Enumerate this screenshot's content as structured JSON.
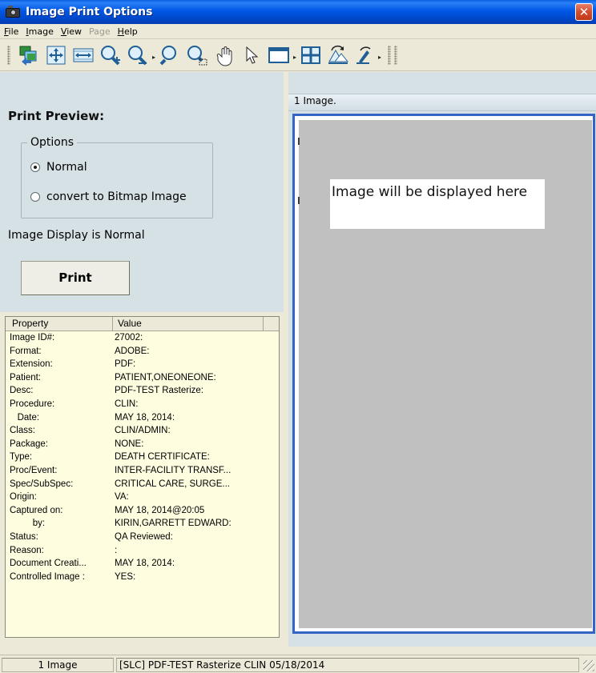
{
  "window": {
    "title": "Image Print Options",
    "close_glyph": "✕"
  },
  "menu": [
    {
      "label": "File",
      "hotkey": "F",
      "rest": "ile",
      "enabled": true
    },
    {
      "label": "Image",
      "hotkey": "I",
      "rest": "mage",
      "enabled": true
    },
    {
      "label": "View",
      "hotkey": "V",
      "rest": "iew",
      "enabled": true
    },
    {
      "label": "Page",
      "hotkey": "P",
      "rest": "age",
      "enabled": false
    },
    {
      "label": "Help",
      "hotkey": "H",
      "rest": "elp",
      "enabled": true
    }
  ],
  "toolbar": {
    "icons": [
      "copy-images-icon",
      "fit-to-window-icon",
      "fit-to-width-icon",
      "zoom-in-icon",
      "zoom-out-icon",
      "zoom-actual-icon",
      "zoom-rectangle-icon",
      "pan-hand-icon",
      "pointer-icon",
      "window-layout-icon",
      "grid-layout-icon",
      "rotate-icon",
      "flip-icon"
    ]
  },
  "left": {
    "print_preview_label": "Print Preview:",
    "options_legend": "Options",
    "radio_normal": "Normal",
    "radio_bitmap": "convert to Bitmap Image",
    "selected_option": "Normal",
    "status_text": "Image Display is Normal",
    "print_label": "Print"
  },
  "properties": {
    "header_property": "Property",
    "header_value": "Value",
    "rows": [
      {
        "k": "Image ID#:",
        "v": "27002:"
      },
      {
        "k": "Format:",
        "v": "ADOBE:"
      },
      {
        "k": "Extension:",
        "v": "PDF:"
      },
      {
        "k": "Patient:",
        "v": "PATIENT,ONEONEONE:"
      },
      {
        "k": "Desc:",
        "v": "PDF-TEST Rasterize:"
      },
      {
        "k": "Procedure:",
        "v": "CLIN:"
      },
      {
        "k": "   Date:",
        "v": "MAY 18, 2014:"
      },
      {
        "k": "Class:",
        "v": "CLIN/ADMIN:"
      },
      {
        "k": "Package:",
        "v": "NONE:"
      },
      {
        "k": "Type:",
        "v": "DEATH CERTIFICATE:"
      },
      {
        "k": "Proc/Event:",
        "v": "INTER-FACILITY TRANSF..."
      },
      {
        "k": "Spec/SubSpec:",
        "v": "CRITICAL CARE, SURGE..."
      },
      {
        "k": "Origin:",
        "v": "VA:"
      },
      {
        "k": "Captured on:",
        "v": "MAY 18, 2014@20:05"
      },
      {
        "k": "         by:",
        "v": "KIRIN,GARRETT EDWARD:"
      },
      {
        "k": "Status:",
        "v": "QA Reviewed:"
      },
      {
        "k": "Reason:",
        "v": ":"
      },
      {
        "k": "Document Creati...",
        "v": "MAY 18, 2014:"
      },
      {
        "k": "Controlled Image :",
        "v": "YES:"
      }
    ]
  },
  "viewer": {
    "image_count": "1 Image.",
    "placeholder": "Image will be displayed here"
  },
  "statusbar": {
    "count": "1 Image",
    "desc": "[SLC] PDF-TEST Rasterize CLIN 05/18/2014"
  },
  "colors": {
    "title_bar": "#0058e6",
    "panel_bg": "#d6e1e6",
    "property_bg": "#fffde0",
    "viewer_border": "#3464c4",
    "viewer_canvas": "#c0c0c0"
  }
}
